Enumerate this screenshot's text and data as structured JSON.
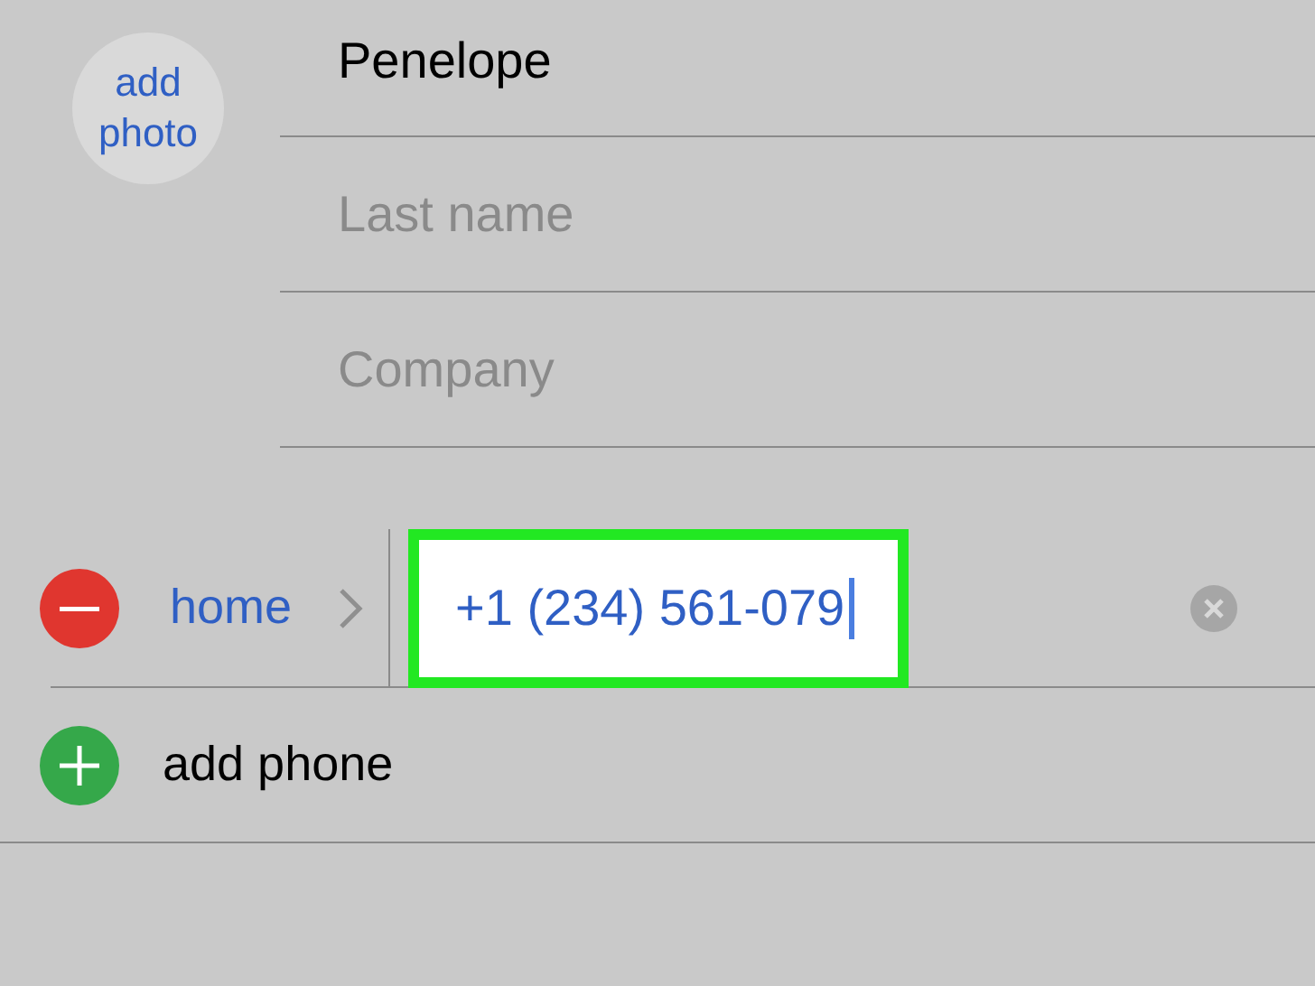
{
  "avatar": {
    "label": "add photo"
  },
  "fields": [
    {
      "value": "Penelope"
    },
    {
      "placeholder": "Last name"
    },
    {
      "placeholder": "Company"
    }
  ],
  "phone": {
    "label": "home",
    "value": "+1 (234) 561-079",
    "highlighted": true
  },
  "add_phone": {
    "label": "add phone"
  }
}
